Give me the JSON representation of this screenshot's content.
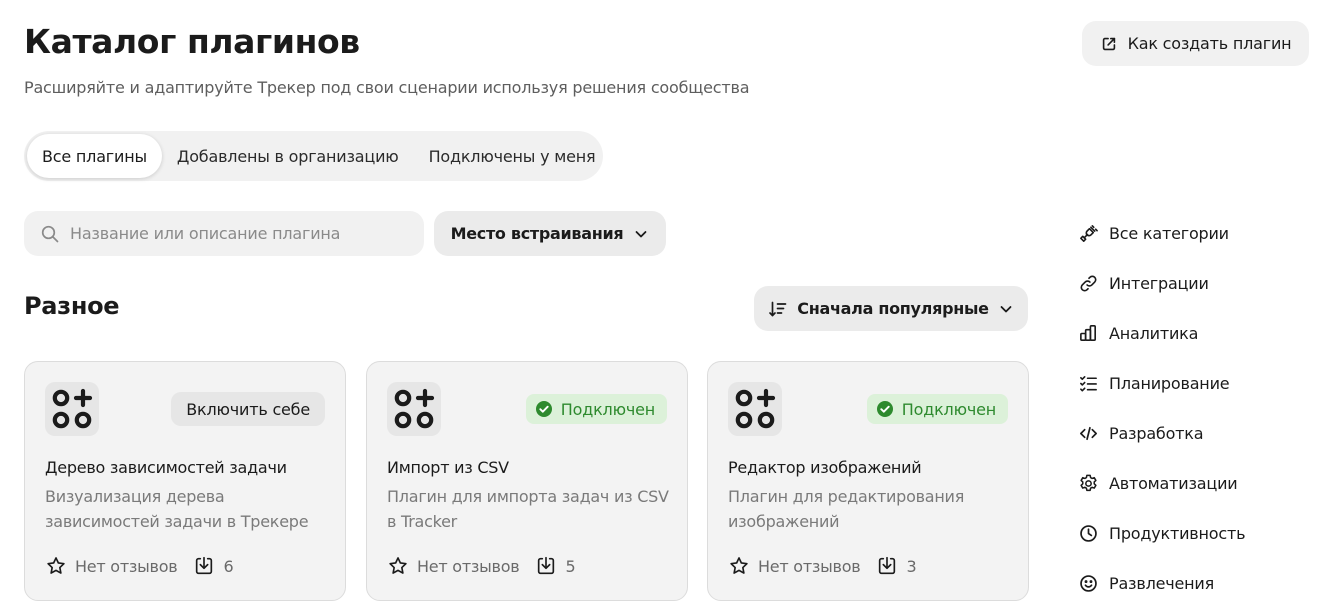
{
  "header": {
    "title": "Каталог плагинов",
    "subtitle": "Расширяйте и адаптируйте Трекер под свои сценарии используя решения сообщества",
    "howto_label": "Как создать плагин"
  },
  "tabs": [
    {
      "label": "Все плагины",
      "active": true
    },
    {
      "label": "Добавлены в организацию",
      "active": false
    },
    {
      "label": "Подключены у меня",
      "active": false
    }
  ],
  "filters": {
    "search_placeholder": "Название или описание плагина",
    "embed_label": "Место встраивания"
  },
  "section": {
    "title": "Разное",
    "sort_label": "Сначала популярные"
  },
  "cards": [
    {
      "title": "Дерево зависимостей задачи",
      "description": "Визуализация дерева зависимостей задачи в Трекере",
      "action": "Включить себе",
      "reviews": "Нет отзывов",
      "downloads": "6"
    },
    {
      "title": "Импорт из CSV",
      "description": "Плагин для импорта задач из CSV в Tracker",
      "status": "Подключен",
      "reviews": "Нет отзывов",
      "downloads": "5"
    },
    {
      "title": "Редактор изображений",
      "description": "Плагин для редактирования изображений",
      "status": "Подключен",
      "reviews": "Нет отзывов",
      "downloads": "3"
    }
  ],
  "categories": [
    {
      "label": "Все категории",
      "icon": "plug-icon"
    },
    {
      "label": "Интеграции",
      "icon": "link-icon"
    },
    {
      "label": "Аналитика",
      "icon": "bar-chart-icon"
    },
    {
      "label": "Планирование",
      "icon": "checklist-icon"
    },
    {
      "label": "Разработка",
      "icon": "code-icon"
    },
    {
      "label": "Автоматизации",
      "icon": "gear-icon"
    },
    {
      "label": "Продуктивность",
      "icon": "clock-icon"
    },
    {
      "label": "Развлечения",
      "icon": "smile-icon"
    }
  ],
  "colors": {
    "connected_bg": "#dcf1d9",
    "connected_text": "#2e8a2e",
    "button_bg": "#ebebeb"
  }
}
